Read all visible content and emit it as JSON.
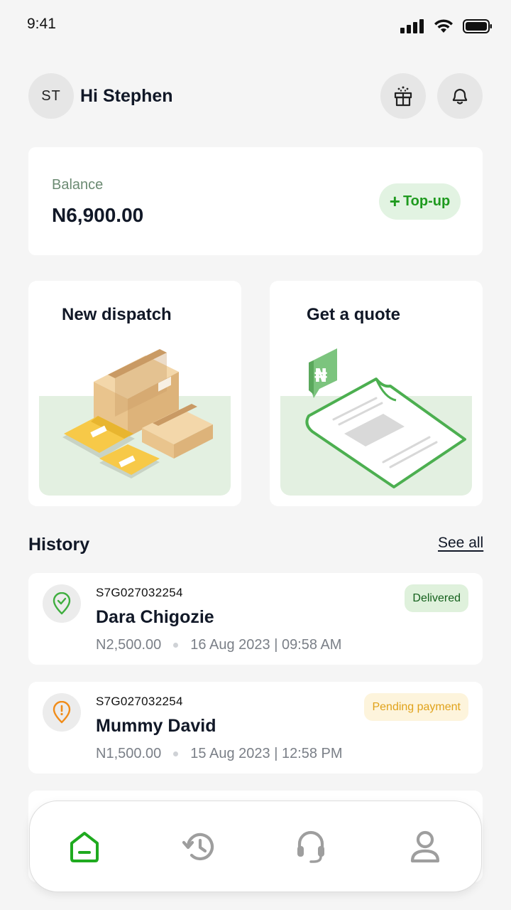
{
  "status_bar": {
    "time": "9:41"
  },
  "header": {
    "avatar_initials": "ST",
    "greeting": "Hi Stephen"
  },
  "balance": {
    "label": "Balance",
    "amount": "N6,900.00",
    "topup_label": "Top-up"
  },
  "actions": [
    {
      "title": "New dispatch",
      "illustration": "packages-icon"
    },
    {
      "title": "Get a quote",
      "illustration": "quote-document-icon"
    }
  ],
  "history": {
    "title": "History",
    "see_all": "See all",
    "items": [
      {
        "id": "S7G027032254",
        "name": "Dara Chigozie",
        "amount": "N2,500.00",
        "date": "16 Aug 2023 | 09:58 AM",
        "status": "Delivered",
        "icon": "check-pin-icon",
        "status_color": "#14601c"
      },
      {
        "id": "S7G027032254",
        "name": "Mummy David",
        "amount": "N1,500.00",
        "date": "15 Aug 2023 | 12:58 PM",
        "status": "Pending payment",
        "icon": "alert-pin-icon",
        "status_color": "#e0a21a"
      }
    ]
  },
  "nav": {
    "items": [
      {
        "name": "home",
        "icon": "home-icon",
        "active": true
      },
      {
        "name": "history",
        "icon": "history-icon",
        "active": false
      },
      {
        "name": "support",
        "icon": "headset-icon",
        "active": false
      },
      {
        "name": "profile",
        "icon": "user-icon",
        "active": false
      }
    ]
  },
  "colors": {
    "accent": "#1faa1f",
    "background": "#f5f5f5",
    "card": "#ffffff",
    "illustration_bg": "#e3f0e1"
  }
}
